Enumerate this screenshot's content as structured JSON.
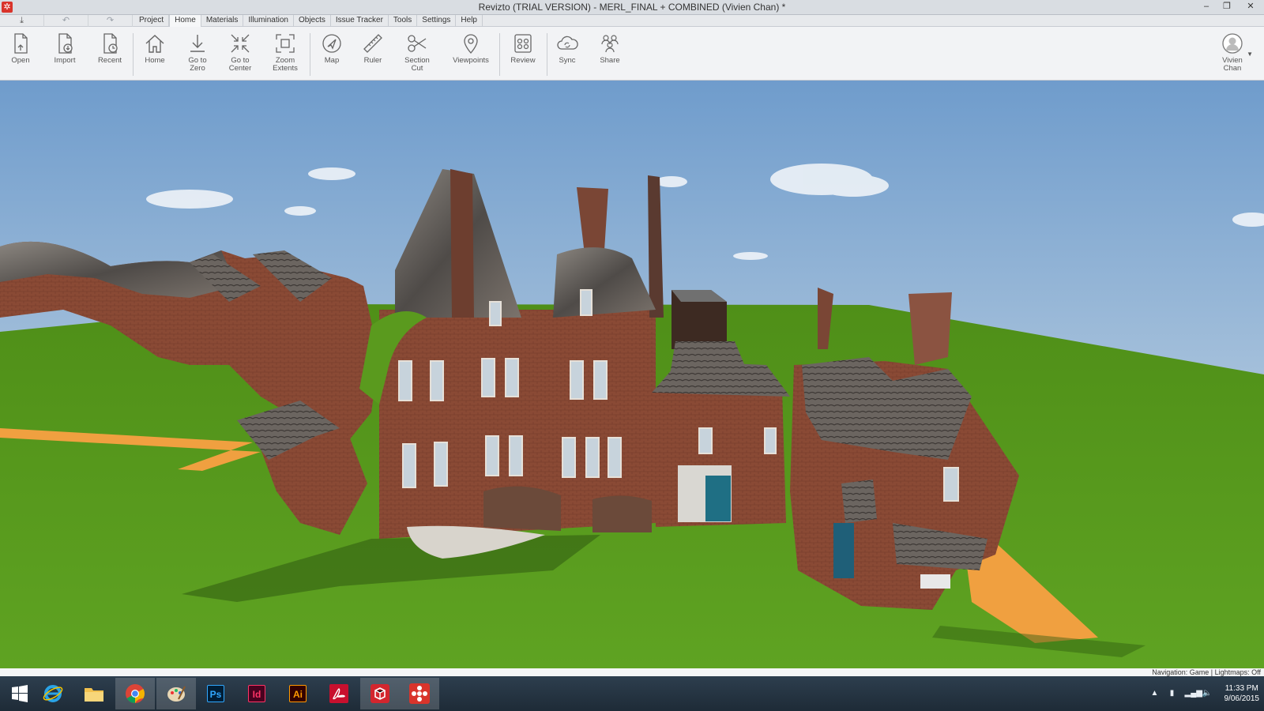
{
  "window": {
    "title": "Revizto (TRIAL VERSION) - MERL_FINAL + COMBINED (Vivien Chan) *",
    "controls": {
      "minimize": "–",
      "restore": "❐",
      "close": "✕"
    }
  },
  "tabs": [
    {
      "label": "Project"
    },
    {
      "label": "Home"
    },
    {
      "label": "Materials"
    },
    {
      "label": "Illumination"
    },
    {
      "label": "Objects"
    },
    {
      "label": "Issue Tracker"
    },
    {
      "label": "Tools"
    },
    {
      "label": "Settings"
    },
    {
      "label": "Help"
    }
  ],
  "active_tab": "Home",
  "ribbon": {
    "open": "Open",
    "import": "Import",
    "recent": "Recent",
    "home": "Home",
    "go_to_zero_1": "Go to",
    "go_to_zero_2": "Zero",
    "go_to_center_1": "Go to",
    "go_to_center_2": "Center",
    "zoom_extents_1": "Zoom",
    "zoom_extents_2": "Extents",
    "map": "Map",
    "ruler": "Ruler",
    "section_cut_1": "Section",
    "section_cut_2": "Cut",
    "viewpoints": "Viewpoints",
    "review": "Review",
    "sync": "Sync",
    "share": "Share",
    "user_first": "Vivien",
    "user_last": "Chan"
  },
  "status": {
    "text": "Navigation: Game | Lightmaps: Off"
  },
  "taskbar": {
    "apps": [
      {
        "name": "Photoshop",
        "label": "Ps",
        "color": "#31a8ff",
        "bg": "#001e36"
      },
      {
        "name": "InDesign",
        "label": "Id",
        "color": "#ff3366",
        "bg": "#49021f"
      },
      {
        "name": "Illustrator",
        "label": "Ai",
        "color": "#ff9a00",
        "bg": "#330000"
      }
    ],
    "time": "11:33 PM",
    "date": "9/06/2015"
  },
  "colors": {
    "accent": "#d9342b",
    "sky_top": "#6f9ccc",
    "grass": "#5a9a1e",
    "path": "#f0a040",
    "brick": "#8a4a35"
  }
}
